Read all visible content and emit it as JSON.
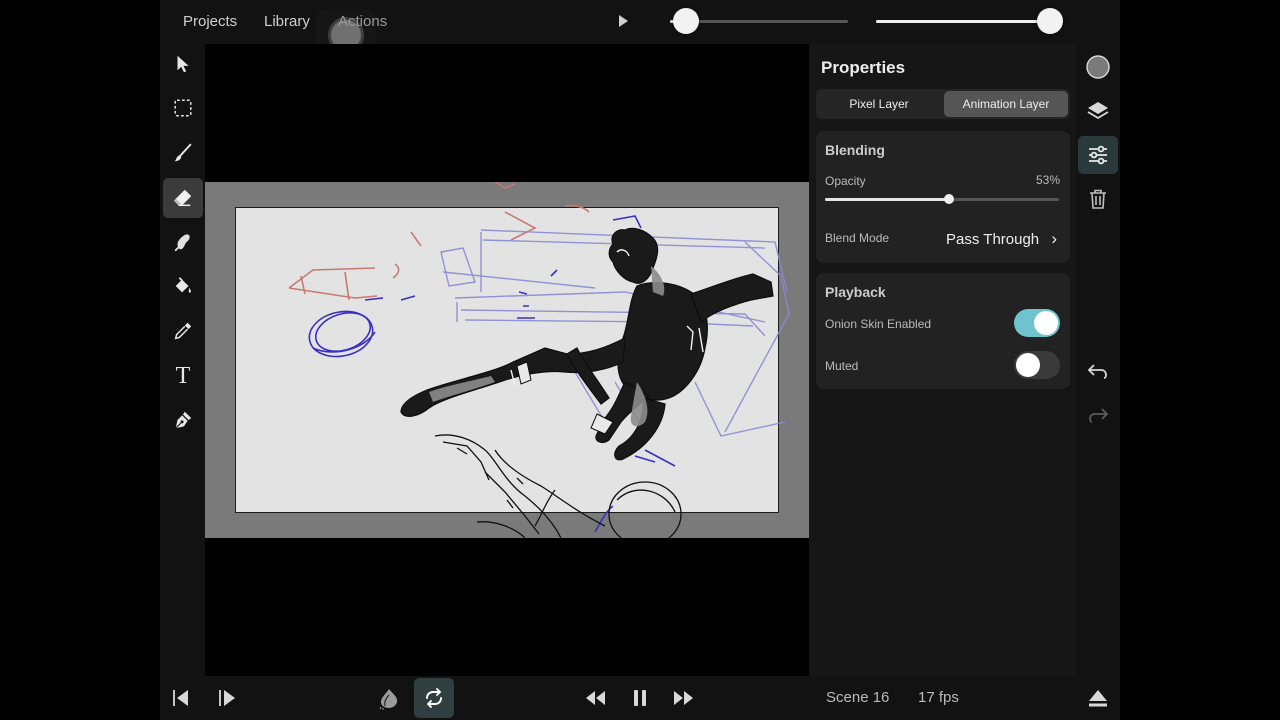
{
  "top_menu": {
    "projects": "Projects",
    "library": "Library",
    "actions": "Actions"
  },
  "timeline": {
    "scrubber_position": 0.09,
    "zoom_position": 0.98
  },
  "tools": [
    {
      "name": "select",
      "icon": "cursor-arrow-icon"
    },
    {
      "name": "marquee",
      "icon": "dashed-selection-icon"
    },
    {
      "name": "brush",
      "icon": "brush-icon"
    },
    {
      "name": "eraser",
      "icon": "eraser-icon",
      "active": true
    },
    {
      "name": "smudge",
      "icon": "smudge-icon"
    },
    {
      "name": "fill",
      "icon": "paint-bucket-icon"
    },
    {
      "name": "eyedropper",
      "icon": "eyedropper-icon"
    },
    {
      "name": "text",
      "icon": "text-tool-icon",
      "glyph": "T"
    },
    {
      "name": "pen",
      "icon": "pen-nib-icon"
    }
  ],
  "properties": {
    "title": "Properties",
    "tabs": [
      {
        "label": "Pixel Layer",
        "selected": false
      },
      {
        "label": "Animation Layer",
        "selected": true
      }
    ],
    "blending": {
      "title": "Blending",
      "opacity_label": "Opacity",
      "opacity_value": "53%",
      "opacity_fraction": 0.53,
      "blend_mode_label": "Blend Mode",
      "blend_mode_value": "Pass Through",
      "chevron": "›"
    },
    "playback": {
      "title": "Playback",
      "onion_label": "Onion Skin Enabled",
      "onion_on": true,
      "muted_label": "Muted",
      "muted_on": false
    }
  },
  "right_icons": [
    "color-swatch-icon",
    "layers-icon",
    "sliders-icon",
    "trash-icon",
    "undo-icon",
    "redo-icon",
    "eject-icon"
  ],
  "bottom": {
    "scene": "Scene 16",
    "fps": "17 fps",
    "icons": [
      "previous-frame-icon",
      "next-frame-icon",
      "onion-icon",
      "loop-icon",
      "rewind-icon",
      "pause-icon",
      "fast-forward-icon"
    ]
  },
  "colors": {
    "accent": "#6fc3cc",
    "panel": "#161616",
    "card": "#222222",
    "mat": "#7a7a7a",
    "paper": "#e3e3e3",
    "sketch_blue": "#4a3fd0",
    "sketch_red": "#c77a72",
    "sketch_lavender": "#8a8ad4"
  }
}
